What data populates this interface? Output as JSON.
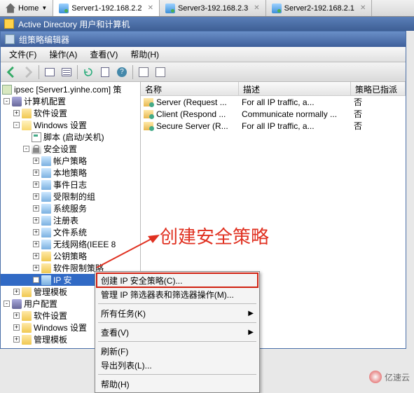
{
  "browser_tabs": {
    "home": "Home",
    "t1": "Server1-192.168.2.2",
    "t2": "Server3-192.168.2.3",
    "t3": "Server2-192.168.2.1"
  },
  "ad_title": "Active Directory 用户和计算机",
  "gpe": {
    "title": "组策略编辑器",
    "menu": {
      "file": "文件(F)",
      "action": "操作(A)",
      "view": "查看(V)",
      "help": "帮助(H)"
    }
  },
  "tree": {
    "root": "ipsec [Server1.yinhe.com] 策",
    "comp_cfg": "计算机配置",
    "sw": "软件设置",
    "win": "Windows 设置",
    "scripts": "脚本 (启动/关机)",
    "sec": "安全设置",
    "acct": "帐户策略",
    "local": "本地策略",
    "evlog": "事件日志",
    "restr": "受限制的组",
    "sys": "系统服务",
    "reg": "注册表",
    "fs": "文件系统",
    "wlan": "无线网络(IEEE 8",
    "pk": "公钥策略",
    "srp": "软件限制策略",
    "ipsec": "IP 安",
    "tmpl": "管理模板",
    "user_cfg": "用户配置",
    "usw": "软件设置",
    "uwin": "Windows 设置",
    "utmpl": "管理模板"
  },
  "list": {
    "hdr": {
      "name": "名称",
      "desc": "描述",
      "assigned": "策略已指派"
    },
    "r1": {
      "name": "Server (Request ...",
      "desc": "For all IP traffic, a...",
      "assigned": "否"
    },
    "r2": {
      "name": "Client (Respond ...",
      "desc": "Communicate normally ...",
      "assigned": "否"
    },
    "r3": {
      "name": "Secure Server (R...",
      "desc": "For all IP traffic, a...",
      "assigned": "否"
    }
  },
  "annotation": "创建安全策略",
  "ctx": {
    "create_ip": "创建 IP 安全策略(C)...",
    "manage": "管理 IP 筛选器表和筛选器操作(M)...",
    "all_tasks": "所有任务(K)",
    "view": "查看(V)",
    "refresh": "刷新(F)",
    "export": "导出列表(L)...",
    "help": "帮助(H)"
  },
  "watermark": "亿速云"
}
